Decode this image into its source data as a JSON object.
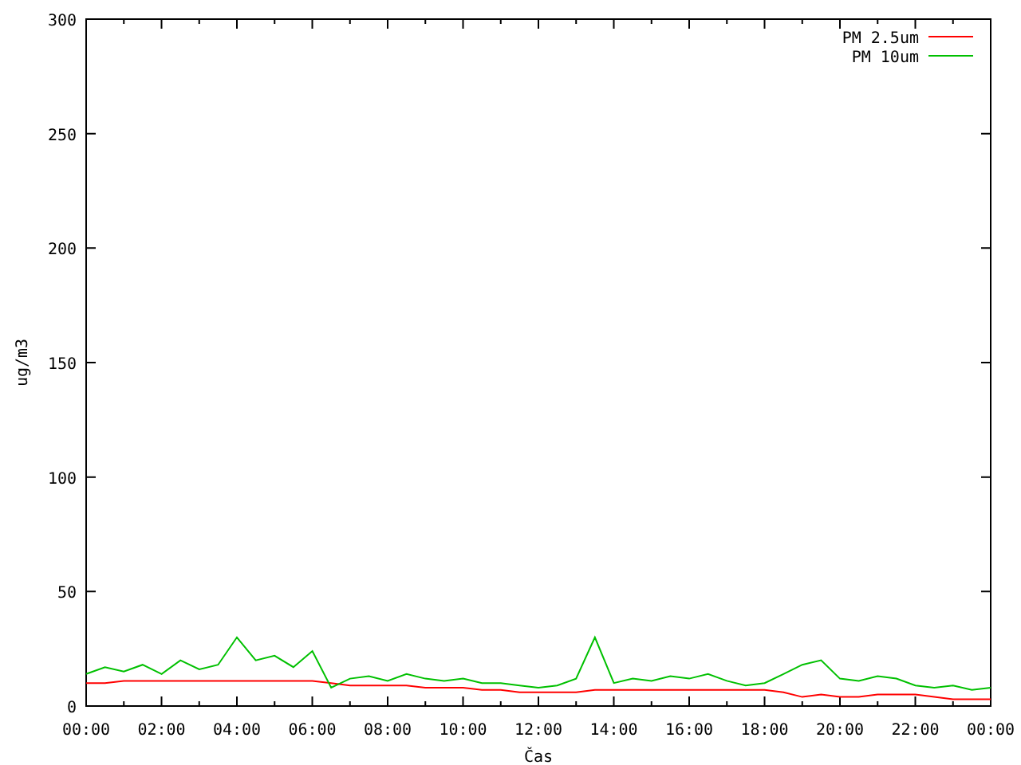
{
  "chart_data": {
    "type": "line",
    "xlabel": "Čas",
    "ylabel": "ug/m3",
    "x": [
      0,
      0.5,
      1,
      1.5,
      2,
      2.5,
      3,
      3.5,
      4,
      4.5,
      5,
      5.5,
      6,
      6.5,
      7,
      7.5,
      8,
      8.5,
      9,
      9.5,
      10,
      10.5,
      11,
      11.5,
      12,
      12.5,
      13,
      13.5,
      14,
      14.5,
      15,
      15.5,
      16,
      16.5,
      17,
      17.5,
      18,
      18.5,
      19,
      19.5,
      20,
      20.5,
      21,
      21.5,
      22,
      22.5,
      23,
      23.5,
      24
    ],
    "series": [
      {
        "name": "PM 2.5um",
        "color": "#ff0000",
        "values": [
          10,
          10,
          11,
          11,
          11,
          11,
          11,
          11,
          11,
          11,
          11,
          11,
          11,
          10,
          9,
          9,
          9,
          9,
          8,
          8,
          8,
          7,
          7,
          6,
          6,
          6,
          6,
          7,
          7,
          7,
          7,
          7,
          7,
          7,
          7,
          7,
          7,
          6,
          4,
          5,
          4,
          4,
          5,
          5,
          5,
          4,
          3,
          3,
          3
        ]
      },
      {
        "name": "PM 10um",
        "color": "#00c000",
        "values": [
          14,
          17,
          15,
          18,
          14,
          20,
          16,
          18,
          30,
          20,
          22,
          17,
          24,
          8,
          12,
          13,
          11,
          14,
          12,
          11,
          12,
          10,
          10,
          9,
          8,
          9,
          12,
          30,
          10,
          12,
          11,
          13,
          12,
          14,
          11,
          9,
          10,
          14,
          18,
          20,
          12,
          11,
          13,
          12,
          9,
          8,
          9,
          7,
          8
        ]
      }
    ],
    "xlim": [
      0,
      24
    ],
    "ylim": [
      0,
      300
    ],
    "xticks": [
      {
        "value": 0,
        "label": "00:00"
      },
      {
        "value": 2,
        "label": "02:00"
      },
      {
        "value": 4,
        "label": "04:00"
      },
      {
        "value": 6,
        "label": "06:00"
      },
      {
        "value": 8,
        "label": "08:00"
      },
      {
        "value": 10,
        "label": "10:00"
      },
      {
        "value": 12,
        "label": "12:00"
      },
      {
        "value": 14,
        "label": "14:00"
      },
      {
        "value": 16,
        "label": "16:00"
      },
      {
        "value": 18,
        "label": "18:00"
      },
      {
        "value": 20,
        "label": "20:00"
      },
      {
        "value": 22,
        "label": "22:00"
      },
      {
        "value": 24,
        "label": "00:00"
      }
    ],
    "yticks": [
      0,
      50,
      100,
      150,
      200,
      250,
      300
    ],
    "legend": true
  }
}
